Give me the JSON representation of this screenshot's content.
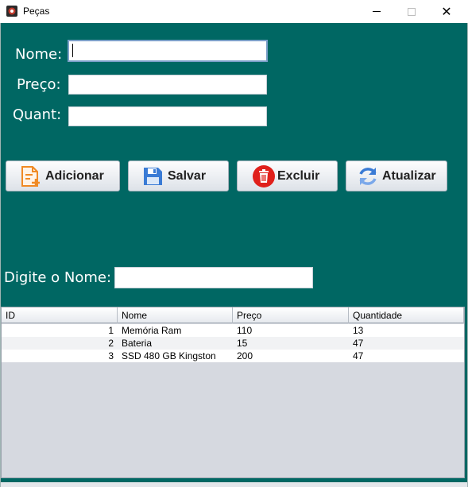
{
  "window": {
    "title": "Peças",
    "icon": "app-logo-icon"
  },
  "form": {
    "nome_label": "Nome:",
    "nome_value": "",
    "preco_label": "Preço:",
    "preco_value": "",
    "quant_label": "Quant:",
    "quant_value": ""
  },
  "buttons": [
    {
      "label": "Adicionar",
      "icon": "add-document-icon"
    },
    {
      "label": "Salvar",
      "icon": "floppy-disk-icon"
    },
    {
      "label": "Excluir",
      "icon": "trash-icon"
    },
    {
      "label": "Atualizar",
      "icon": "refresh-icon"
    }
  ],
  "search": {
    "label": "Digite o Nome:",
    "value": ""
  },
  "table": {
    "columns": [
      "ID",
      "Nome",
      "Preço",
      "Quantidade"
    ],
    "rows": [
      {
        "id": "1",
        "nome": "Memória Ram",
        "preco": "110",
        "quantidade": "13"
      },
      {
        "id": "2",
        "nome": "Bateria",
        "preco": "15",
        "quantidade": "47"
      },
      {
        "id": "3",
        "nome": "SSD 480 GB Kingston",
        "preco": "200",
        "quantidade": "47"
      }
    ]
  },
  "colors": {
    "panel_background": "#006763",
    "delete_icon": "#e0201b",
    "save_icon": "#3a7bd5",
    "add_icon": "#f08a24"
  }
}
